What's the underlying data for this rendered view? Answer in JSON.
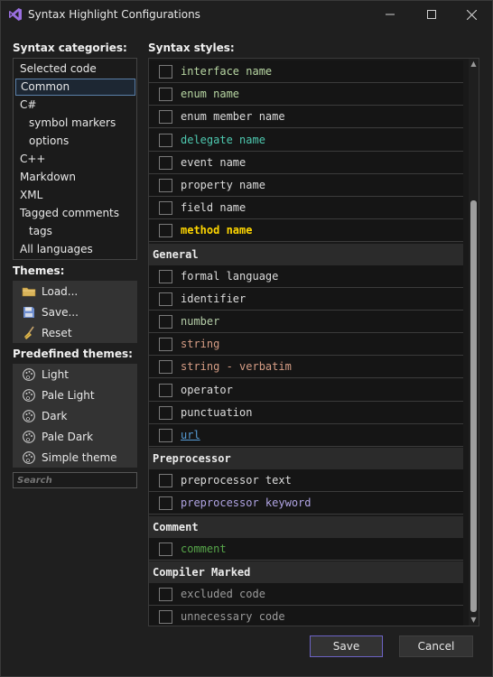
{
  "window": {
    "title": "Syntax Highlight Configurations"
  },
  "labels": {
    "categories": "Syntax categories:",
    "styles": "Syntax styles:",
    "themes": "Themes:",
    "predefined": "Predefined themes:"
  },
  "categories": [
    {
      "label": "Selected code",
      "indent": false,
      "selected": false
    },
    {
      "label": "Common",
      "indent": false,
      "selected": true
    },
    {
      "label": "C#",
      "indent": false,
      "selected": false
    },
    {
      "label": "symbol markers",
      "indent": true,
      "selected": false
    },
    {
      "label": "options",
      "indent": true,
      "selected": false
    },
    {
      "label": "C++",
      "indent": false,
      "selected": false
    },
    {
      "label": "Markdown",
      "indent": false,
      "selected": false
    },
    {
      "label": "XML",
      "indent": false,
      "selected": false
    },
    {
      "label": "Tagged comments",
      "indent": false,
      "selected": false
    },
    {
      "label": "tags",
      "indent": true,
      "selected": false
    },
    {
      "label": "All languages",
      "indent": false,
      "selected": false
    }
  ],
  "themes": [
    {
      "label": "Load...",
      "icon": "folder-icon"
    },
    {
      "label": "Save...",
      "icon": "save-icon"
    },
    {
      "label": "Reset",
      "icon": "broom-icon"
    }
  ],
  "predefined_themes": [
    {
      "label": "Light",
      "icon": "palette-icon"
    },
    {
      "label": "Pale Light",
      "icon": "palette-icon"
    },
    {
      "label": "Dark",
      "icon": "palette-icon"
    },
    {
      "label": "Pale Dark",
      "icon": "palette-icon"
    },
    {
      "label": "Simple theme",
      "icon": "palette-icon"
    }
  ],
  "search": {
    "placeholder": "Search"
  },
  "styles": {
    "top_rows": [
      {
        "label": "interface name",
        "color": "#b8d7a3"
      },
      {
        "label": "enum name",
        "color": "#b8d7a3"
      },
      {
        "label": "enum member name",
        "color": "#dcdcdc"
      },
      {
        "label": "delegate name",
        "color": "#4ec9b0"
      },
      {
        "label": "event name",
        "color": "#dcdcdc"
      },
      {
        "label": "property name",
        "color": "#dcdcdc"
      },
      {
        "label": "field name",
        "color": "#dcdcdc"
      },
      {
        "label": "method name",
        "color": "#ffd700",
        "bold": true
      }
    ],
    "groups": [
      {
        "header": "General",
        "rows": [
          {
            "label": "formal language",
            "color": "#dcdcdc"
          },
          {
            "label": "identifier",
            "color": "#dcdcdc"
          },
          {
            "label": "number",
            "color": "#b5cea8"
          },
          {
            "label": "string",
            "color": "#d69d85"
          },
          {
            "label": "string - verbatim",
            "color": "#d69d85"
          },
          {
            "label": "operator",
            "color": "#dcdcdc"
          },
          {
            "label": "punctuation",
            "color": "#dcdcdc"
          },
          {
            "label": "url",
            "color": "#569cd6",
            "underline": true
          }
        ]
      },
      {
        "header": "Preprocessor",
        "rows": [
          {
            "label": "preprocessor text",
            "color": "#dcdcdc"
          },
          {
            "label": "preprocessor keyword",
            "color": "#b0a4e3"
          }
        ]
      },
      {
        "header": "Comment",
        "rows": [
          {
            "label": "comment",
            "color": "#57a64a"
          }
        ]
      },
      {
        "header": "Compiler Marked",
        "rows": [
          {
            "label": "excluded code",
            "color": "#9b9b9b"
          },
          {
            "label": "unnecessary code",
            "color": "#9b9b9b"
          }
        ]
      }
    ]
  },
  "buttons": {
    "save": "Save",
    "cancel": "Cancel"
  },
  "colors": {
    "accent": "#6c63c4",
    "selection_border": "#5a7fa8"
  }
}
